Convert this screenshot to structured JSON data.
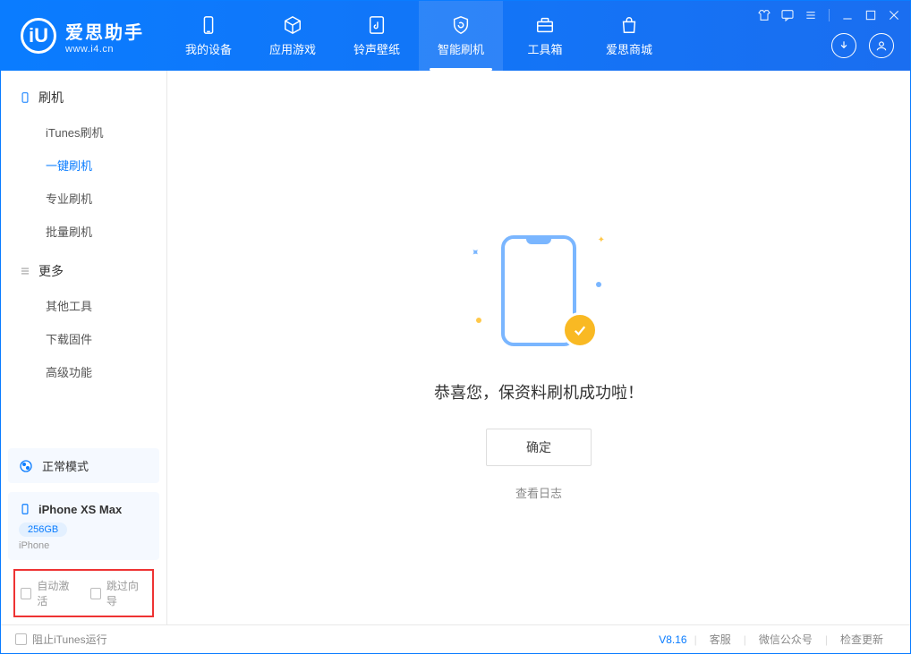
{
  "app": {
    "title": "爱思助手",
    "subtitle": "www.i4.cn",
    "logo_letter": "iU"
  },
  "nav": {
    "items": [
      {
        "label": "我的设备"
      },
      {
        "label": "应用游戏"
      },
      {
        "label": "铃声壁纸"
      },
      {
        "label": "智能刷机"
      },
      {
        "label": "工具箱"
      },
      {
        "label": "爱思商城"
      }
    ],
    "active_index": 3
  },
  "sidebar": {
    "section_flash": "刷机",
    "section_more": "更多",
    "flash_items": [
      {
        "label": "iTunes刷机"
      },
      {
        "label": "一键刷机"
      },
      {
        "label": "专业刷机"
      },
      {
        "label": "批量刷机"
      }
    ],
    "flash_active_index": 1,
    "more_items": [
      {
        "label": "其他工具"
      },
      {
        "label": "下载固件"
      },
      {
        "label": "高级功能"
      }
    ]
  },
  "mode_card": {
    "label": "正常模式"
  },
  "device": {
    "name": "iPhone XS Max",
    "capacity": "256GB",
    "type": "iPhone"
  },
  "options": {
    "auto_activate": "自动激活",
    "skip_guide": "跳过向导"
  },
  "main": {
    "success_text": "恭喜您，保资料刷机成功啦！",
    "ok_button": "确定",
    "view_log": "查看日志"
  },
  "statusbar": {
    "block_itunes": "阻止iTunes运行",
    "version": "V8.16",
    "links": {
      "support": "客服",
      "wechat": "微信公众号",
      "update": "检查更新"
    }
  }
}
